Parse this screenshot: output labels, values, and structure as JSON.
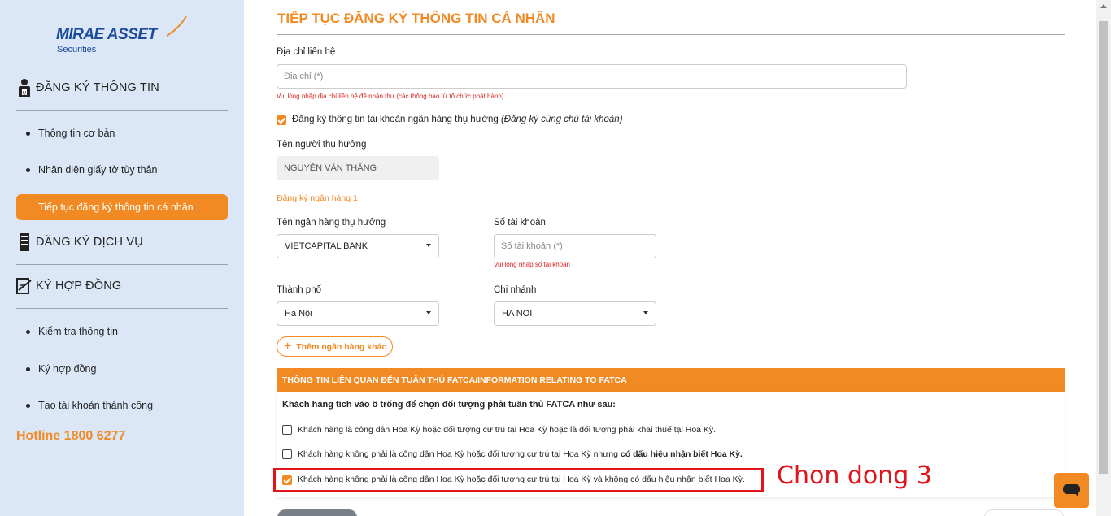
{
  "sidebar": {
    "logo": {
      "main": "MIRAE ASSET",
      "sub": "Securities"
    },
    "section1": {
      "title": "ĐĂNG KÝ THÔNG TIN",
      "icon": "user-icon"
    },
    "section1_items": [
      "Thông tin cơ bản",
      "Nhận diện giấy tờ tùy thân"
    ],
    "active_item": "Tiếp tục đăng ký thông tin cá nhân",
    "section2": {
      "title": "ĐĂNG KÝ DỊCH VỤ",
      "icon": "document-icon"
    },
    "section3": {
      "title": "KÝ HỢP ĐỒNG",
      "icon": "signature-icon"
    },
    "section3_items": [
      "Kiểm tra thông tin",
      "Ký hợp đồng",
      "Tạo tài khoản thành công"
    ],
    "hotline": "Hotline 1800 6277"
  },
  "main": {
    "page_title": "TIẾP TỤC ĐĂNG KÝ THÔNG TIN CÁ NHÂN",
    "address": {
      "label": "Địa chỉ liên hệ",
      "placeholder": "Địa chỉ (*)",
      "error": "Vui lòng nhập địa chỉ liên hệ để nhận thư (các thông báo từ tổ chức phát hành)"
    },
    "bank_register": {
      "checked": true,
      "label_bold": "Đăng ký thông tin tài khoản ngân hàng thụ hưởng",
      "label_note": "(Đăng ký cùng chủ tài khoản)"
    },
    "beneficiary": {
      "label": "Tên người thụ hưởng",
      "value": "NGUYỄN VĂN THẮNG"
    },
    "bank_section_title": "Đăng ký ngân hàng 1",
    "bank_name": {
      "label": "Tên ngân hàng thụ hưởng",
      "value": "VIETCAPITAL BANK"
    },
    "account_no": {
      "label": "Số tài khoản",
      "placeholder": "Số tài khoản (*)",
      "error": "Vui lòng nhập số tài khoản"
    },
    "city": {
      "label": "Thành phố",
      "value": "Hà Nội"
    },
    "branch": {
      "label": "Chi nhánh",
      "value": "HA NOI"
    },
    "add_bank_button": "Thêm ngân hàng khác",
    "fatca": {
      "header": "THÔNG TIN LIÊN QUAN ĐẾN TUÂN THỦ FATCA/INFORMATION RELATING TO FATCA",
      "question": "Khách hàng tích vào ô trống để chọn đối tượng phải tuân thủ FATCA như sau:",
      "options": [
        {
          "text": "Khách hàng là công dân Hoa Kỳ hoặc đối tượng cư trú tại Hoa Kỳ hoặc là đối tượng phải khai thuế tại Hoa Kỳ.",
          "bold": "",
          "checked": false
        },
        {
          "text": "Khách hàng không phải là công dân Hoa Kỳ hoặc đối tượng cư trú tại Hoa Kỳ nhưng ",
          "bold": "có dấu hiệu nhận biết Hoa Kỳ.",
          "checked": false
        },
        {
          "text": "Khách hàng không phải là công dân Hoa Kỳ hoặc đối tượng cư trú tại Hoa Kỳ và không có dấu hiệu nhận biết Hoa Kỳ.",
          "bold": "",
          "checked": true
        }
      ]
    },
    "annotation": "Chon dong 3"
  },
  "colors": {
    "accent": "#f28a23",
    "sidebar_bg": "#dbe7f6",
    "error": "#dd2222",
    "annotation": "#e0141a"
  }
}
